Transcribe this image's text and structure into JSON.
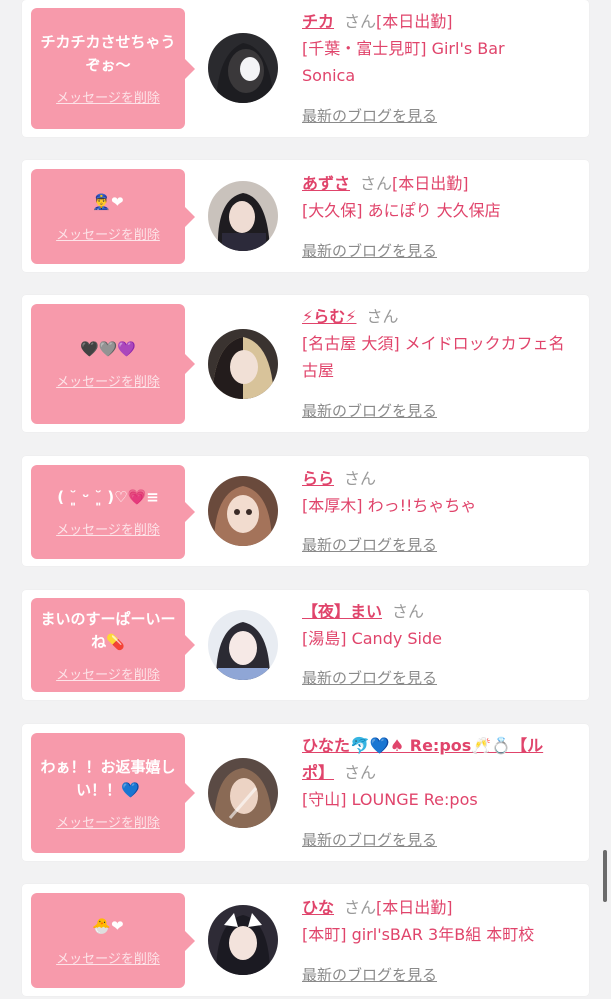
{
  "items": [
    {
      "message": "チカチカさせちゃうぞぉ〜",
      "delete_label": "メッセージを削除",
      "name": "チカ",
      "honorific": "さん",
      "status": "[本日出勤]",
      "shop": "[千葉・富士見町] Girl's Bar Sonica",
      "blog_label": "最新のブログを見る"
    },
    {
      "message": "👮‍♂️❤",
      "delete_label": "メッセージを削除",
      "name": "あずさ",
      "honorific": "さん",
      "status": "[本日出勤]",
      "shop": "[大久保] あにぽり 大久保店",
      "blog_label": "最新のブログを見る"
    },
    {
      "message": "🖤🩶💜",
      "delete_label": "メッセージを削除",
      "name": "⚡らむ⚡",
      "honorific": "さん",
      "status": "",
      "shop": "[名古屋 大須] メイドロックカフェ名古屋",
      "blog_label": "最新のブログを見る"
    },
    {
      "message": "( ˘͈ ᵕ ˘͈ )♡💗≡",
      "delete_label": "メッセージを削除",
      "name": "らら",
      "honorific": "さん",
      "status": "",
      "shop": "[本厚木] わっ!!ちゃちゃ",
      "blog_label": "最新のブログを見る"
    },
    {
      "message": "まいのすーぱーいーね💊",
      "delete_label": "メッセージを削除",
      "name": "【夜】まい",
      "honorific": "さん",
      "status": "",
      "shop": "[湯島] Candy Side",
      "blog_label": "最新のブログを見る"
    },
    {
      "message": "わぁ！！お返事嬉しい！！💙",
      "delete_label": "メッセージを削除",
      "name": "ひなた🐬💙♠ Re:pos🥂💍【ルポ】",
      "honorific": "さん",
      "status": "",
      "shop": "[守山] LOUNGE Re:pos",
      "blog_label": "最新のブログを見る"
    },
    {
      "message": "🐣❤",
      "delete_label": "メッセージを削除",
      "name": "ひな",
      "honorific": "さん",
      "status": "[本日出勤]",
      "shop": "[本町] girl'sBAR 3年B組 本町校",
      "blog_label": "最新のブログを見る"
    }
  ],
  "colors": {
    "accent": "#e0446b",
    "bubble": "#f79aab",
    "muted": "#8a8a8a",
    "background": "#f2f2f3"
  }
}
